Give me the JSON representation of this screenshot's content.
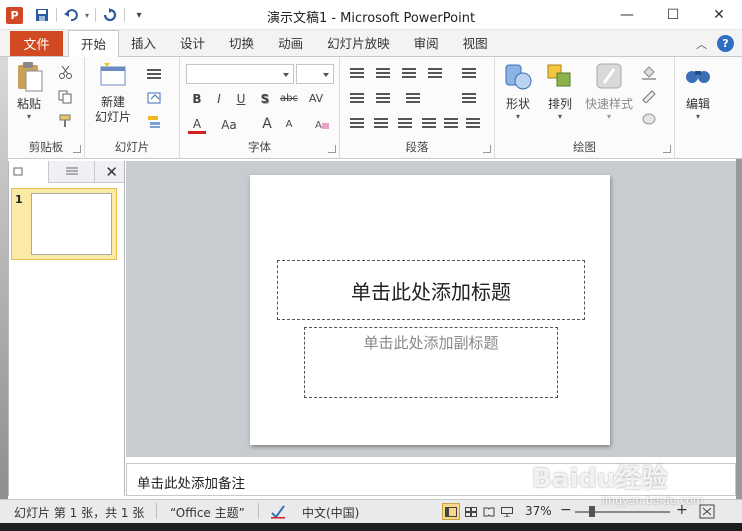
{
  "window": {
    "title": "演示文稿1 - Microsoft PowerPoint",
    "app_icon_letter": "P",
    "controls": {
      "minimize": "—",
      "maximize": "☐",
      "close": "✕"
    }
  },
  "qat": {
    "save_icon": "save-icon",
    "undo_icon": "undo-icon",
    "redo_icon": "redo-icon",
    "customize": "▾"
  },
  "tabs": {
    "file": "文件",
    "items": [
      "开始",
      "插入",
      "设计",
      "切换",
      "动画",
      "幻灯片放映",
      "审阅",
      "视图"
    ],
    "active": "开始"
  },
  "ribbon_right": {
    "collapse_icon": "chevron-up-icon",
    "help": "?"
  },
  "ribbon": {
    "clipboard": {
      "paste_label": "粘贴",
      "group_label": "剪贴板"
    },
    "slides": {
      "new_slide_label": "新建\n幻灯片",
      "new_slide_line1": "新建",
      "new_slide_line2": "幻灯片",
      "group_label": "幻灯片"
    },
    "font": {
      "font_name_value": "",
      "font_size_value": "",
      "bold": "B",
      "italic": "I",
      "underline": "U",
      "shadow": "S",
      "strike": "abc",
      "spacing": "AV",
      "font_color": "A",
      "change_case": "Aa",
      "grow": "A",
      "shrink": "A",
      "group_label": "字体"
    },
    "paragraph": {
      "group_label": "段落"
    },
    "drawing": {
      "shapes_label": "形状",
      "arrange_label": "排列",
      "quick_styles_label": "快速样式",
      "group_label": "绘图"
    },
    "editing": {
      "edit_label": "编辑"
    }
  },
  "left_panel": {
    "close": "✕",
    "slide_number": "1"
  },
  "slide": {
    "title_placeholder": "单击此处添加标题",
    "subtitle_placeholder": "单击此处添加副标题"
  },
  "notes": {
    "placeholder": "单击此处添加备注"
  },
  "statusbar": {
    "slide_info": "幻灯片 第 1 张，共 1 张",
    "theme": "“Office 主题”",
    "language": "中文(中国)",
    "zoom": "37%",
    "zoom_out": "−",
    "zoom_in": "+"
  },
  "watermark": {
    "text": "Baidu经验",
    "sub": "jingyan.baidu.com"
  },
  "colors": {
    "file_tab": "#d14a22",
    "thumb_selected": "#fde9a6",
    "canvas_bg": "#c8cbd0"
  }
}
